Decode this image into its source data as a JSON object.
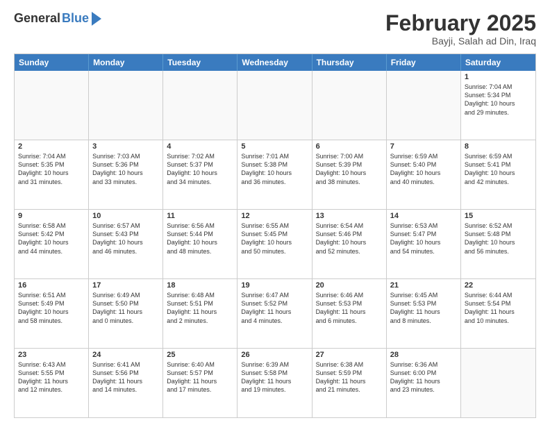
{
  "header": {
    "logo_general": "General",
    "logo_blue": "Blue",
    "title": "February 2025",
    "location": "Bayji, Salah ad Din, Iraq"
  },
  "days_of_week": [
    "Sunday",
    "Monday",
    "Tuesday",
    "Wednesday",
    "Thursday",
    "Friday",
    "Saturday"
  ],
  "weeks": [
    [
      {
        "day": "",
        "empty": true,
        "lines": []
      },
      {
        "day": "",
        "empty": true,
        "lines": []
      },
      {
        "day": "",
        "empty": true,
        "lines": []
      },
      {
        "day": "",
        "empty": true,
        "lines": []
      },
      {
        "day": "",
        "empty": true,
        "lines": []
      },
      {
        "day": "",
        "empty": true,
        "lines": []
      },
      {
        "day": "1",
        "empty": false,
        "lines": [
          "Sunrise: 7:04 AM",
          "Sunset: 5:34 PM",
          "Daylight: 10 hours",
          "and 29 minutes."
        ]
      }
    ],
    [
      {
        "day": "2",
        "empty": false,
        "lines": [
          "Sunrise: 7:04 AM",
          "Sunset: 5:35 PM",
          "Daylight: 10 hours",
          "and 31 minutes."
        ]
      },
      {
        "day": "3",
        "empty": false,
        "lines": [
          "Sunrise: 7:03 AM",
          "Sunset: 5:36 PM",
          "Daylight: 10 hours",
          "and 33 minutes."
        ]
      },
      {
        "day": "4",
        "empty": false,
        "lines": [
          "Sunrise: 7:02 AM",
          "Sunset: 5:37 PM",
          "Daylight: 10 hours",
          "and 34 minutes."
        ]
      },
      {
        "day": "5",
        "empty": false,
        "lines": [
          "Sunrise: 7:01 AM",
          "Sunset: 5:38 PM",
          "Daylight: 10 hours",
          "and 36 minutes."
        ]
      },
      {
        "day": "6",
        "empty": false,
        "lines": [
          "Sunrise: 7:00 AM",
          "Sunset: 5:39 PM",
          "Daylight: 10 hours",
          "and 38 minutes."
        ]
      },
      {
        "day": "7",
        "empty": false,
        "lines": [
          "Sunrise: 6:59 AM",
          "Sunset: 5:40 PM",
          "Daylight: 10 hours",
          "and 40 minutes."
        ]
      },
      {
        "day": "8",
        "empty": false,
        "lines": [
          "Sunrise: 6:59 AM",
          "Sunset: 5:41 PM",
          "Daylight: 10 hours",
          "and 42 minutes."
        ]
      }
    ],
    [
      {
        "day": "9",
        "empty": false,
        "lines": [
          "Sunrise: 6:58 AM",
          "Sunset: 5:42 PM",
          "Daylight: 10 hours",
          "and 44 minutes."
        ]
      },
      {
        "day": "10",
        "empty": false,
        "lines": [
          "Sunrise: 6:57 AM",
          "Sunset: 5:43 PM",
          "Daylight: 10 hours",
          "and 46 minutes."
        ]
      },
      {
        "day": "11",
        "empty": false,
        "lines": [
          "Sunrise: 6:56 AM",
          "Sunset: 5:44 PM",
          "Daylight: 10 hours",
          "and 48 minutes."
        ]
      },
      {
        "day": "12",
        "empty": false,
        "lines": [
          "Sunrise: 6:55 AM",
          "Sunset: 5:45 PM",
          "Daylight: 10 hours",
          "and 50 minutes."
        ]
      },
      {
        "day": "13",
        "empty": false,
        "lines": [
          "Sunrise: 6:54 AM",
          "Sunset: 5:46 PM",
          "Daylight: 10 hours",
          "and 52 minutes."
        ]
      },
      {
        "day": "14",
        "empty": false,
        "lines": [
          "Sunrise: 6:53 AM",
          "Sunset: 5:47 PM",
          "Daylight: 10 hours",
          "and 54 minutes."
        ]
      },
      {
        "day": "15",
        "empty": false,
        "lines": [
          "Sunrise: 6:52 AM",
          "Sunset: 5:48 PM",
          "Daylight: 10 hours",
          "and 56 minutes."
        ]
      }
    ],
    [
      {
        "day": "16",
        "empty": false,
        "lines": [
          "Sunrise: 6:51 AM",
          "Sunset: 5:49 PM",
          "Daylight: 10 hours",
          "and 58 minutes."
        ]
      },
      {
        "day": "17",
        "empty": false,
        "lines": [
          "Sunrise: 6:49 AM",
          "Sunset: 5:50 PM",
          "Daylight: 11 hours",
          "and 0 minutes."
        ]
      },
      {
        "day": "18",
        "empty": false,
        "lines": [
          "Sunrise: 6:48 AM",
          "Sunset: 5:51 PM",
          "Daylight: 11 hours",
          "and 2 minutes."
        ]
      },
      {
        "day": "19",
        "empty": false,
        "lines": [
          "Sunrise: 6:47 AM",
          "Sunset: 5:52 PM",
          "Daylight: 11 hours",
          "and 4 minutes."
        ]
      },
      {
        "day": "20",
        "empty": false,
        "lines": [
          "Sunrise: 6:46 AM",
          "Sunset: 5:53 PM",
          "Daylight: 11 hours",
          "and 6 minutes."
        ]
      },
      {
        "day": "21",
        "empty": false,
        "lines": [
          "Sunrise: 6:45 AM",
          "Sunset: 5:53 PM",
          "Daylight: 11 hours",
          "and 8 minutes."
        ]
      },
      {
        "day": "22",
        "empty": false,
        "lines": [
          "Sunrise: 6:44 AM",
          "Sunset: 5:54 PM",
          "Daylight: 11 hours",
          "and 10 minutes."
        ]
      }
    ],
    [
      {
        "day": "23",
        "empty": false,
        "lines": [
          "Sunrise: 6:43 AM",
          "Sunset: 5:55 PM",
          "Daylight: 11 hours",
          "and 12 minutes."
        ]
      },
      {
        "day": "24",
        "empty": false,
        "lines": [
          "Sunrise: 6:41 AM",
          "Sunset: 5:56 PM",
          "Daylight: 11 hours",
          "and 14 minutes."
        ]
      },
      {
        "day": "25",
        "empty": false,
        "lines": [
          "Sunrise: 6:40 AM",
          "Sunset: 5:57 PM",
          "Daylight: 11 hours",
          "and 17 minutes."
        ]
      },
      {
        "day": "26",
        "empty": false,
        "lines": [
          "Sunrise: 6:39 AM",
          "Sunset: 5:58 PM",
          "Daylight: 11 hours",
          "and 19 minutes."
        ]
      },
      {
        "day": "27",
        "empty": false,
        "lines": [
          "Sunrise: 6:38 AM",
          "Sunset: 5:59 PM",
          "Daylight: 11 hours",
          "and 21 minutes."
        ]
      },
      {
        "day": "28",
        "empty": false,
        "lines": [
          "Sunrise: 6:36 AM",
          "Sunset: 6:00 PM",
          "Daylight: 11 hours",
          "and 23 minutes."
        ]
      },
      {
        "day": "",
        "empty": true,
        "lines": []
      }
    ]
  ]
}
